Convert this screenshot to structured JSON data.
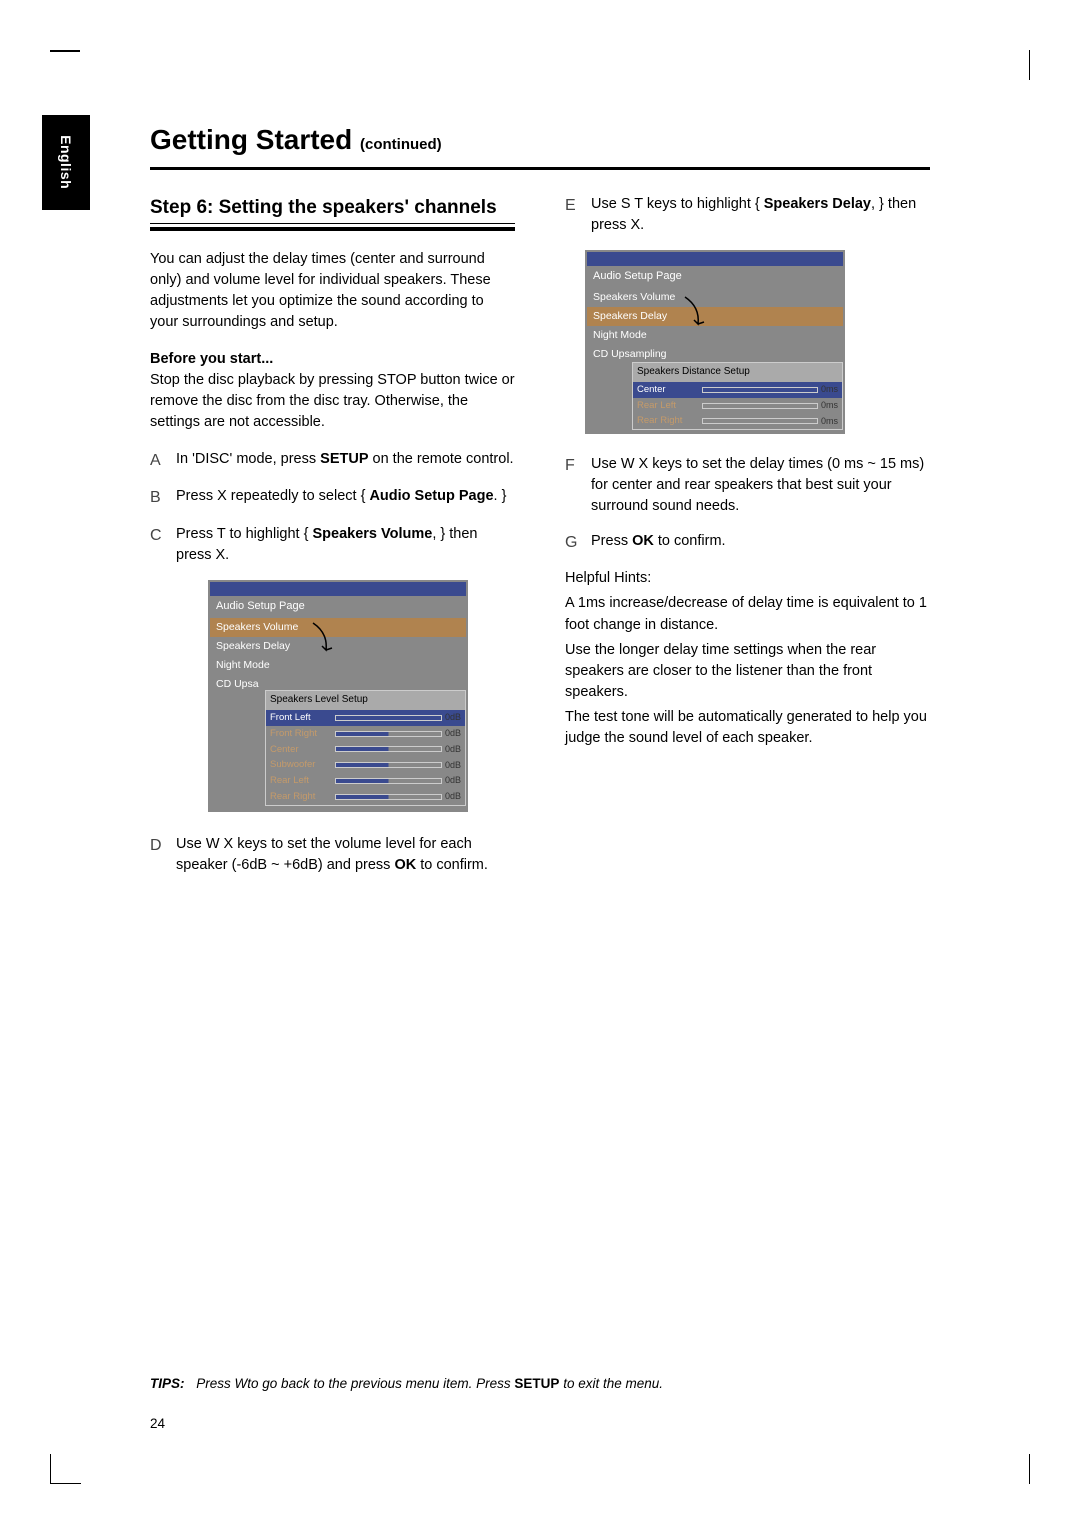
{
  "lang_tab": "English",
  "heading": "Getting Started",
  "heading_cont": "(continued)",
  "step_title": "Step 6:  Setting the speakers' channels",
  "intro": "You can adjust the delay times (center and surround only) and volume level for individual speakers.  These adjustments let you optimize the sound according to your surroundings and setup.",
  "before_label": "Before you start...",
  "before_text": "Stop the disc playback by pressing STOP button twice or remove the disc from the disc tray.  Otherwise, the settings are not accessible.",
  "stepA": {
    "letter": "A",
    "t1": "In 'DISC' mode, press ",
    "b1": "SETUP",
    "t2": " on the remote control."
  },
  "stepB": {
    "letter": "B",
    "t1": "Press  X repeatedly to select { ",
    "b1": "Audio Setup Page",
    "t2": ". }"
  },
  "stepC": {
    "letter": "C",
    "t1": "Press  T to highlight { ",
    "b1": "Speakers Volume",
    "t2": ", } then press  X."
  },
  "stepD": {
    "letter": "D",
    "t1": "Use  W X keys to set the volume level for each speaker (-6dB ~ +6dB) and press ",
    "b1": "OK",
    "t2": " to confirm."
  },
  "stepE": {
    "letter": "E",
    "t1": "Use  S T keys to highlight { ",
    "b1": "Speakers Delay",
    "t2": ", } then press  X."
  },
  "stepF": {
    "letter": "F",
    "t1": "Use  W X keys to set the delay times (0 ms ~ 15 ms) for center and rear speakers that best suit your surround sound needs."
  },
  "stepG": {
    "letter": "G",
    "t1": "Press ",
    "b1": "OK",
    "t2": " to confirm."
  },
  "hints_label": "Helpful Hints:",
  "hint1": "  A 1ms increase/decrease of delay time is equivalent to 1 foot change in distance.",
  "hint2": "  Use the longer delay time settings when the rear speakers are closer to the listener than the front speakers.",
  "hint3": "  The test tone will be automatically generated to help you judge the sound level of each speaker.",
  "osd1": {
    "page_title": "Audio Setup Page",
    "menu": [
      "Speakers Volume",
      "Speakers Delay",
      "Night Mode",
      "CD Upsa"
    ],
    "active_idx": 0,
    "submenu_title": "Speakers Level Setup",
    "rows": [
      {
        "label": "Front Left",
        "value": "0dB",
        "active": true
      },
      {
        "label": "Front Right",
        "value": "0dB"
      },
      {
        "label": "Center",
        "value": "0dB"
      },
      {
        "label": "Subwoofer",
        "value": "0dB"
      },
      {
        "label": "Rear Left",
        "value": "0dB"
      },
      {
        "label": "Rear Right",
        "value": "0dB"
      }
    ]
  },
  "osd2": {
    "page_title": "Audio Setup Page",
    "menu": [
      "Speakers Volume",
      "Speakers Delay",
      "Night Mode",
      "CD Upsampling"
    ],
    "active_idx": 1,
    "submenu_title": "Speakers Distance Setup",
    "rows": [
      {
        "label": "Center",
        "value": "0ms",
        "active": true
      },
      {
        "label": "Rear Left",
        "value": "0ms"
      },
      {
        "label": "Rear Right",
        "value": "0ms"
      }
    ]
  },
  "tips_label": "TIPS:",
  "tips_t1": "Press Wto go back to the previous menu item.  Press ",
  "tips_b1": "SETUP",
  "tips_t2": " to exit the menu.",
  "page_number": "24"
}
